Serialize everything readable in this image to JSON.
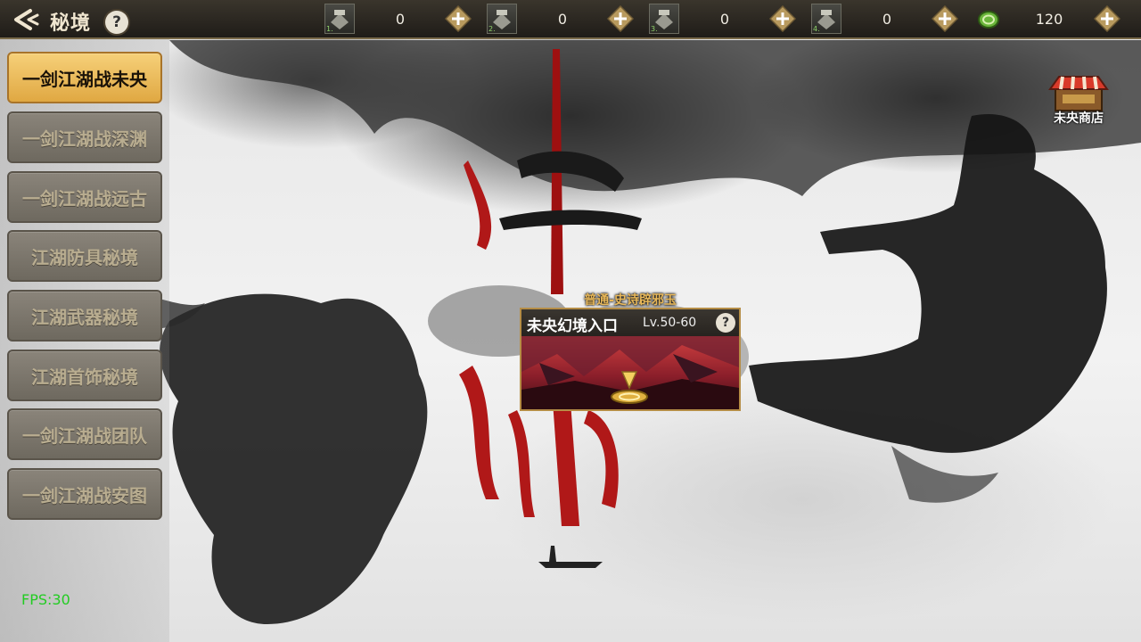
{
  "header": {
    "title": "秘境",
    "help_symbol": "?",
    "resources": [
      {
        "icon": "ticket-1-icon",
        "tag": "1.",
        "value": "0"
      },
      {
        "icon": "ticket-2-icon",
        "tag": "2.",
        "value": "0"
      },
      {
        "icon": "ticket-3-icon",
        "tag": "3.",
        "value": "0"
      },
      {
        "icon": "ticket-4-icon",
        "tag": "4.",
        "value": "0"
      },
      {
        "icon": "coin-icon",
        "value": "120"
      }
    ]
  },
  "sidebar": {
    "items": [
      {
        "label": "一剑江湖战未央",
        "active": true
      },
      {
        "label": "一剑江湖战深渊",
        "active": false
      },
      {
        "label": "一剑江湖战远古",
        "active": false
      },
      {
        "label": "江湖防具秘境",
        "active": false
      },
      {
        "label": "江湖武器秘境",
        "active": false
      },
      {
        "label": "江湖首饰秘境",
        "active": false
      },
      {
        "label": "一剑江湖战团队",
        "active": false
      },
      {
        "label": "一剑江湖战安图",
        "active": false
      }
    ]
  },
  "shop": {
    "label": "未央商店"
  },
  "entrance": {
    "subtitle": "普通-史诗辟邪玉",
    "title": "未央幻境入口",
    "level": "Lv.50-60",
    "help_symbol": "?"
  },
  "fps": "FPS:30",
  "colors": {
    "accent_gold": "#e0a842",
    "fps_green": "#22cc22",
    "ink_red": "#b01818"
  }
}
